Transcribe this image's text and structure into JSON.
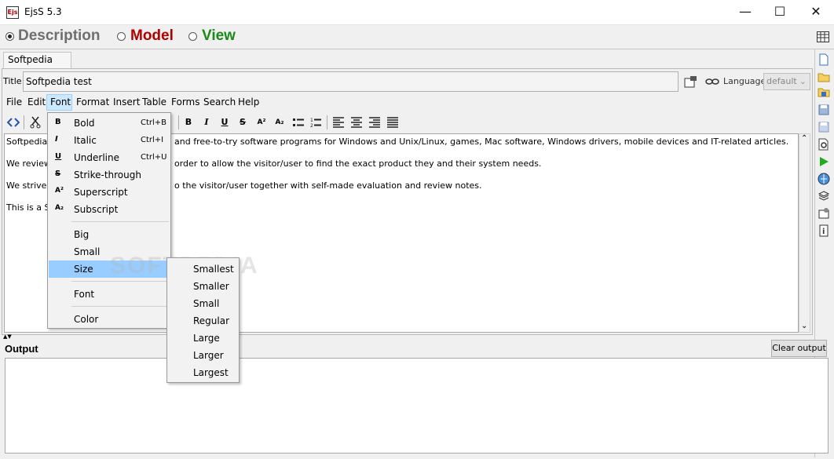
{
  "window": {
    "title": "EjsS 5.3",
    "icon_text": "Ejs",
    "minimize": "—",
    "maximize": "☐",
    "close": "✕"
  },
  "modes": [
    {
      "label": "Description",
      "color": "#6f6f6f",
      "selected": true
    },
    {
      "label": "Model",
      "color": "#b00000",
      "selected": false
    },
    {
      "label": "View",
      "color": "#1a8a1a",
      "selected": false
    }
  ],
  "tab": {
    "label": "Softpedia test"
  },
  "title_field": {
    "label": "Title:",
    "value": "Softpedia test"
  },
  "language": {
    "label": "Language:",
    "value": "default"
  },
  "menubar": [
    "File",
    "Edit",
    "Font",
    "Format",
    "Insert",
    "Table",
    "Forms",
    "Search",
    "Help"
  ],
  "format_toolbar": {
    "bold": "B",
    "italic": "I",
    "underline": "U",
    "strike": "S",
    "superscript": "A²",
    "subscript": "A₂"
  },
  "editor": {
    "paragraphs": [
      "Softpedia is",
      "We review",
      "We strive t",
      "This is a So"
    ],
    "paragraph_tails": [
      "and free-to-try software programs for Windows and Unix/Linux, games, Mac software, Windows drivers, mobile devices and IT-related articles.",
      "order to allow the visitor/user to find the exact product they and their system needs.",
      "o the visitor/user together with self-made evaluation and review notes.",
      ""
    ]
  },
  "font_menu": {
    "items": [
      {
        "icon": "B",
        "label": "Bold",
        "shortcut": "Ctrl+B"
      },
      {
        "icon": "I",
        "label": "Italic",
        "shortcut": "Ctrl+I"
      },
      {
        "icon": "U",
        "label": "Underline",
        "shortcut": "Ctrl+U"
      },
      {
        "icon": "S",
        "label": "Strike-through",
        "shortcut": ""
      },
      {
        "icon": "A²",
        "label": "Superscript",
        "shortcut": ""
      },
      {
        "icon": "A₂",
        "label": "Subscript",
        "shortcut": ""
      }
    ],
    "size_items": [
      "Big",
      "Small",
      "Size"
    ],
    "font": "Font",
    "color": "Color"
  },
  "size_menu": [
    "Smallest",
    "Smaller",
    "Small",
    "Regular",
    "Large",
    "Larger",
    "Largest"
  ],
  "output": {
    "label": "Output",
    "clear_button": "Clear output"
  },
  "watermark": "SOFTPEDIA",
  "colors": {
    "menu_highlight": "#99ccff",
    "menubar_highlight": "#cce8ff"
  }
}
